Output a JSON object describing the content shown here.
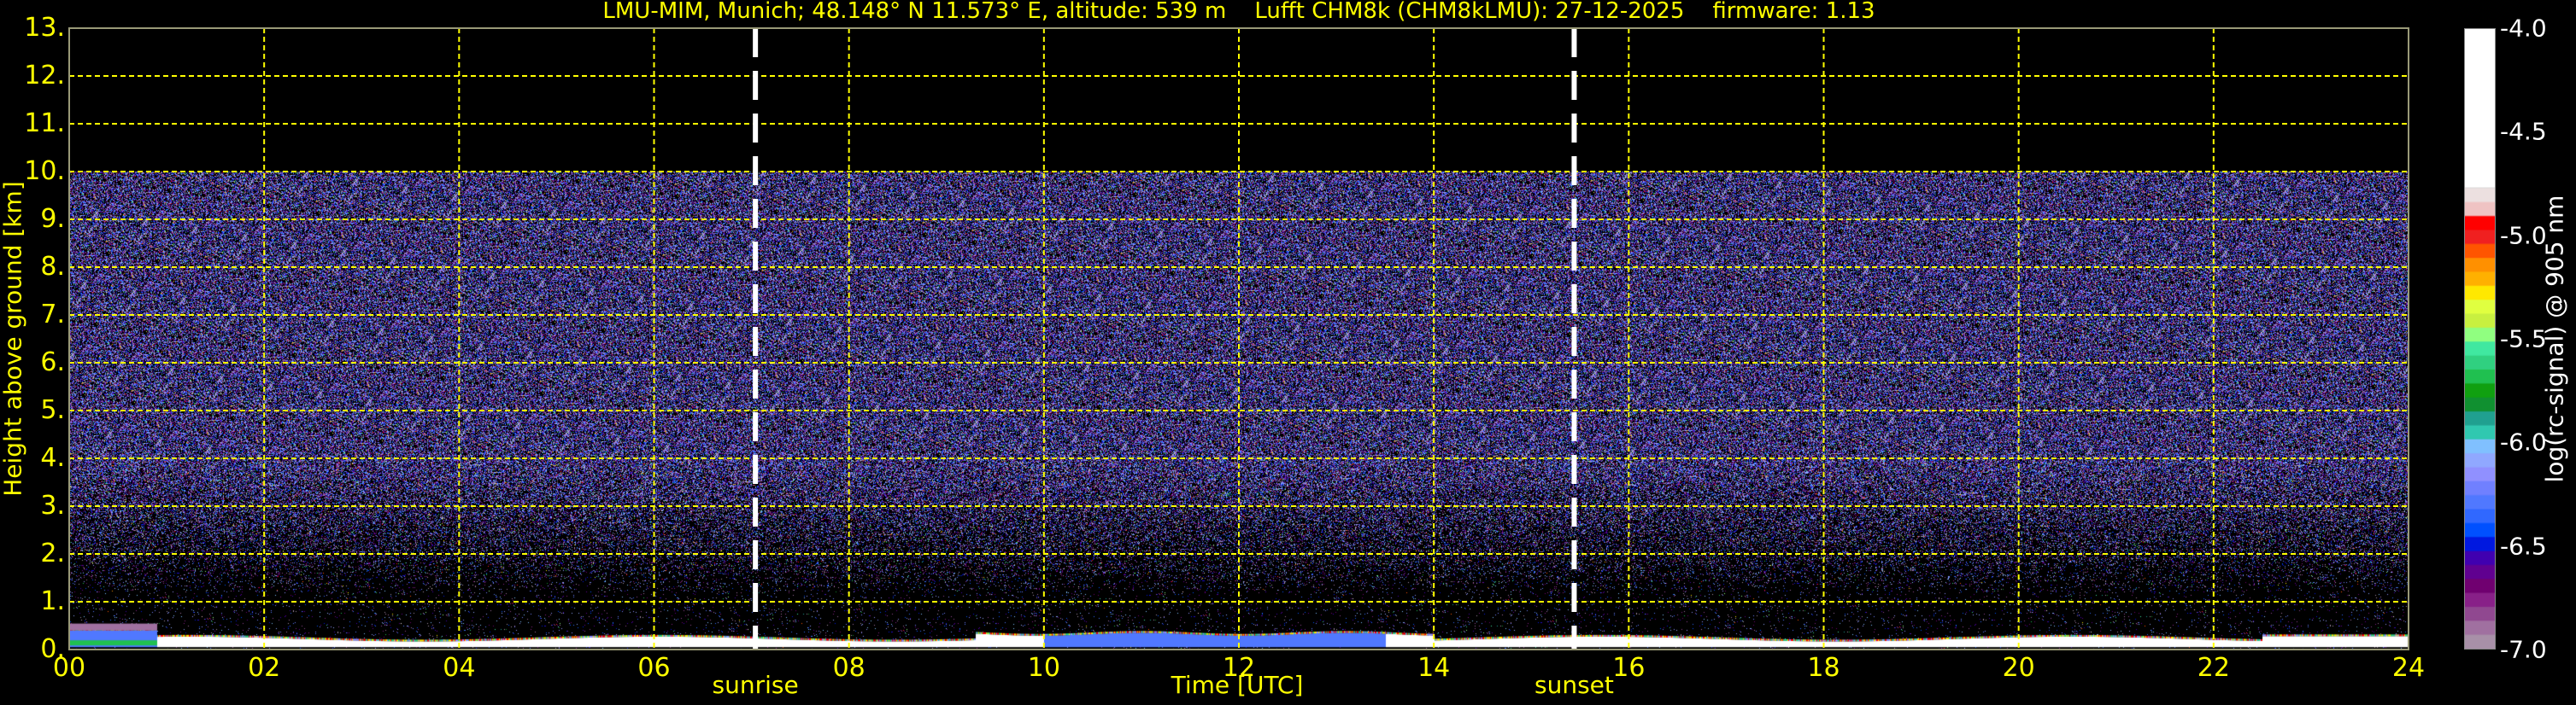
{
  "chart_data": {
    "type": "heatmap",
    "title": "LMU-MIM, Munich; 48.148° N 11.573° E, altitude: 539 m    Lufft CHM8k (CHM8kLMU): 27-12-2025    firmware: 1.13",
    "xlabel": "Time [UTC]",
    "ylabel": "Height above ground [km]",
    "xlim": [
      0,
      24
    ],
    "ylim": [
      0,
      13
    ],
    "x_ticks": [
      "00",
      "02",
      "04",
      "06",
      "08",
      "10",
      "12",
      "14",
      "16",
      "18",
      "20",
      "22",
      "24"
    ],
    "y_ticks": [
      "0.",
      "1.",
      "2.",
      "3.",
      "4.",
      "5.",
      "6.",
      "7.",
      "8.",
      "9.",
      "10.",
      "11.",
      "12.",
      "13."
    ],
    "grid": true,
    "grid_color": "#ffff00",
    "signal_top_km": 10,
    "boundary_layer_top_km": 0.25,
    "events": [
      {
        "label": "sunrise",
        "time_h": 7.04
      },
      {
        "label": "sunset",
        "time_h": 15.44
      }
    ],
    "colorbar": {
      "label": "log(rc-signal) @ 905 nm",
      "range": [
        -7.0,
        -4.0
      ],
      "ticks": [
        "-4.0",
        "-4.5",
        "-5.0",
        "-5.5",
        "-6.0",
        "-6.5",
        "-7.0"
      ],
      "white_above": -4.77,
      "colors_high_to_low": [
        "#ece0e0",
        "#efc3c3",
        "#ff0000",
        "#f02020",
        "#ff5500",
        "#ff9000",
        "#ffb000",
        "#ffe800",
        "#e0ff40",
        "#c8f040",
        "#90ff80",
        "#40e8a0",
        "#30d080",
        "#20c050",
        "#10a010",
        "#109030",
        "#20a090",
        "#30c8b0",
        "#80c0ff",
        "#90a8ff",
        "#9090ff",
        "#7080ff",
        "#5078ff",
        "#3068ff",
        "#0050ff",
        "#0018e0",
        "#4000b0",
        "#600090",
        "#700070",
        "#882088",
        "#904890",
        "#a070a0",
        "#a890a8"
      ]
    }
  }
}
